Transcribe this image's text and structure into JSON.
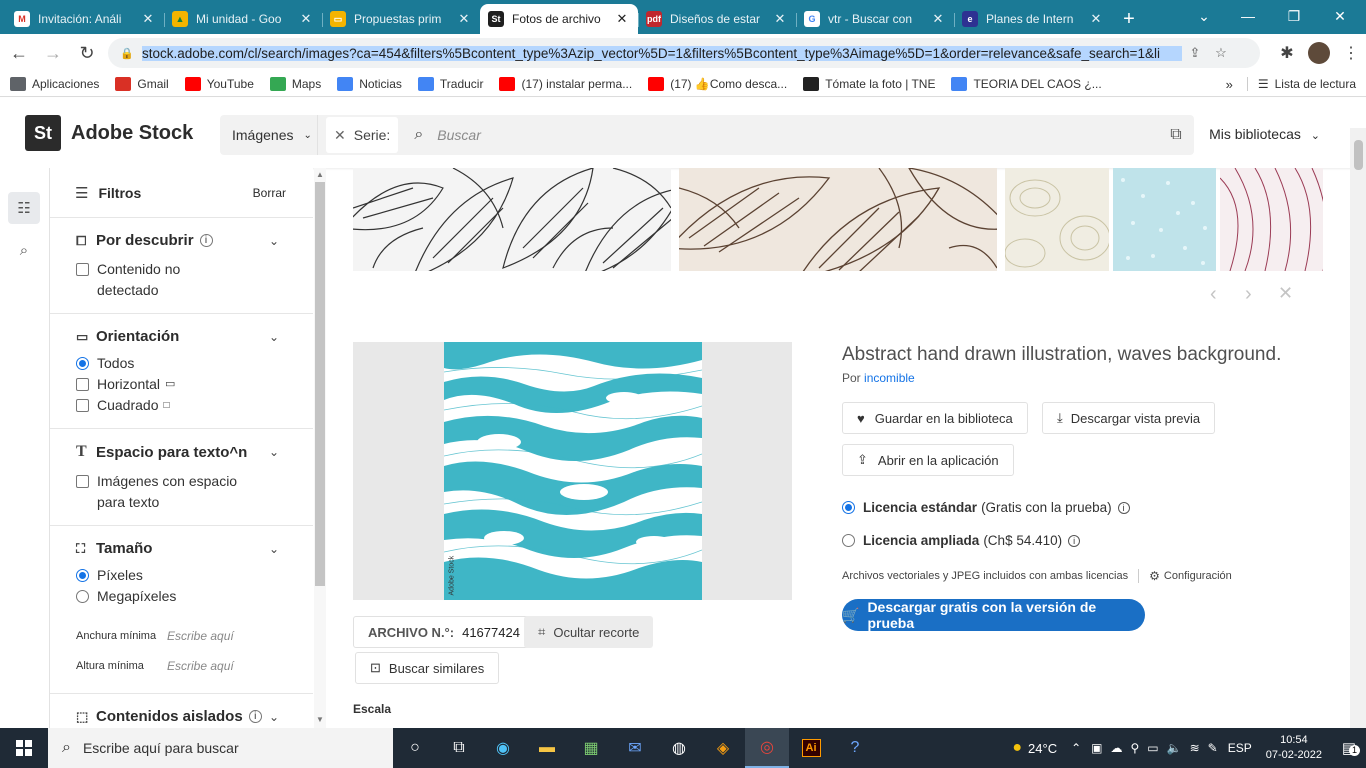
{
  "browser": {
    "tabs": [
      {
        "label": "Invitación: Análi",
        "icon": "gmail-icon",
        "color": "#ffffff",
        "glyph": "M",
        "fg": "#d93025"
      },
      {
        "label": "Mi unidad - Goo",
        "icon": "drive-icon",
        "color": "#f4b400",
        "glyph": "▲",
        "fg": "#188038"
      },
      {
        "label": "Propuestas prim",
        "icon": "slides-icon",
        "color": "#f4b400",
        "glyph": "▭",
        "fg": "#ffffff"
      },
      {
        "label": "Fotos de archivo",
        "icon": "adobe-stock-icon",
        "color": "#1f1f1f",
        "glyph": "St",
        "fg": "#ffffff",
        "active": true
      },
      {
        "label": "Diseños de estar",
        "icon": "pdf-icon",
        "color": "#c0272d",
        "glyph": "pdf",
        "fg": "#ffffff"
      },
      {
        "label": "vtr - Buscar con",
        "icon": "google-icon",
        "color": "#ffffff",
        "glyph": "G",
        "fg": "#4285f4"
      },
      {
        "label": "Planes de Intern",
        "icon": "vtr-icon",
        "color": "#2e3192",
        "glyph": "e",
        "fg": "#ffffff"
      }
    ],
    "url": "stock.adobe.com/cl/search/images?ca=454&filters%5Bcontent_type%3Azip_vector%5D=1&filters%5Bcontent_type%3Aimage%5D=1&order=relevance&safe_search=1&li",
    "bookmarks": [
      {
        "label": "Aplicaciones",
        "icon": "apps-grid-icon",
        "color": "#5f6368"
      },
      {
        "label": "Gmail",
        "icon": "gmail-icon",
        "color": "#d93025"
      },
      {
        "label": "YouTube",
        "icon": "youtube-icon",
        "color": "#ff0000"
      },
      {
        "label": "Maps",
        "icon": "maps-icon",
        "color": "#34a853"
      },
      {
        "label": "Noticias",
        "icon": "news-icon",
        "color": "#4285f4"
      },
      {
        "label": "Traducir",
        "icon": "translate-icon",
        "color": "#4285f4"
      },
      {
        "label": "(17) instalar perma...",
        "icon": "youtube-icon",
        "color": "#ff0000"
      },
      {
        "label": "(17) 👍Como desca...",
        "icon": "youtube-icon",
        "color": "#ff0000"
      },
      {
        "label": "Tómate la foto | TNE",
        "icon": "tne-icon",
        "color": "#222222"
      },
      {
        "label": "TEORIA DEL CAOS ¿...",
        "icon": "google-icon",
        "color": "#4285f4"
      }
    ],
    "reading_list": "Lista de lectura"
  },
  "header": {
    "logo_mark": "St",
    "logo_text": "Adobe Stock",
    "type_select": "Imágenes",
    "chip_label": "Serie:",
    "search_placeholder": "Buscar",
    "my_libraries": "Mis bibliotecas"
  },
  "filters": {
    "title": "Filtros",
    "clear": "Borrar",
    "sections": {
      "discover": {
        "title": "Por descubrir",
        "options": [
          "Contenido no detectado"
        ]
      },
      "orientation": {
        "title": "Orientación",
        "options": [
          "Todos",
          "Horizontal",
          "Cuadrado"
        ]
      },
      "copyspace": {
        "title": "Espacio para texto^n",
        "options": [
          "Imágenes con espacio para texto"
        ]
      },
      "size": {
        "title": "Tamaño",
        "options": [
          "Píxeles",
          "Megapíxeles"
        ],
        "min_width_label": "Anchura mínima",
        "min_height_label": "Altura mínima",
        "placeholder": "Escribe aquí"
      },
      "isolated": {
        "title": "Contenidos aislados"
      }
    }
  },
  "detail": {
    "title": "Abstract hand drawn illustration, waves background.",
    "by_prefix": "Por",
    "author": "incomible",
    "save_label": "Guardar en la biblioteca",
    "preview_label": "Descargar vista previa",
    "open_app_label": "Abrir en la aplicación",
    "standard_license": "Licencia estándar",
    "standard_note": "(Gratis con la prueba)",
    "extended_license": "Licencia ampliada",
    "extended_note": "(Ch$ 54.410)",
    "formats_note": "Archivos vectoriales y JPEG incluidos con ambas licencias",
    "config_label": "Configuración",
    "cta_label": "Descargar gratis con la versión de prueba",
    "file_label": "ARCHIVO N.°:",
    "file_number": "41677424",
    "hide_crop": "Ocultar recorte",
    "similar": "Buscar similares",
    "scale_label": "Escala",
    "watermark": "Adobe Stock"
  },
  "taskbar": {
    "search_placeholder": "Escribe aquí para buscar",
    "weather": "24°C",
    "lang": "ESP",
    "time": "10:54",
    "date": "07-02-2022",
    "notif_count": "1"
  },
  "colors": {
    "accent": "#1473e6",
    "tabbar": "#1b7a96",
    "wave": "#3fb6c6",
    "taskbar": "#1f2a36"
  }
}
